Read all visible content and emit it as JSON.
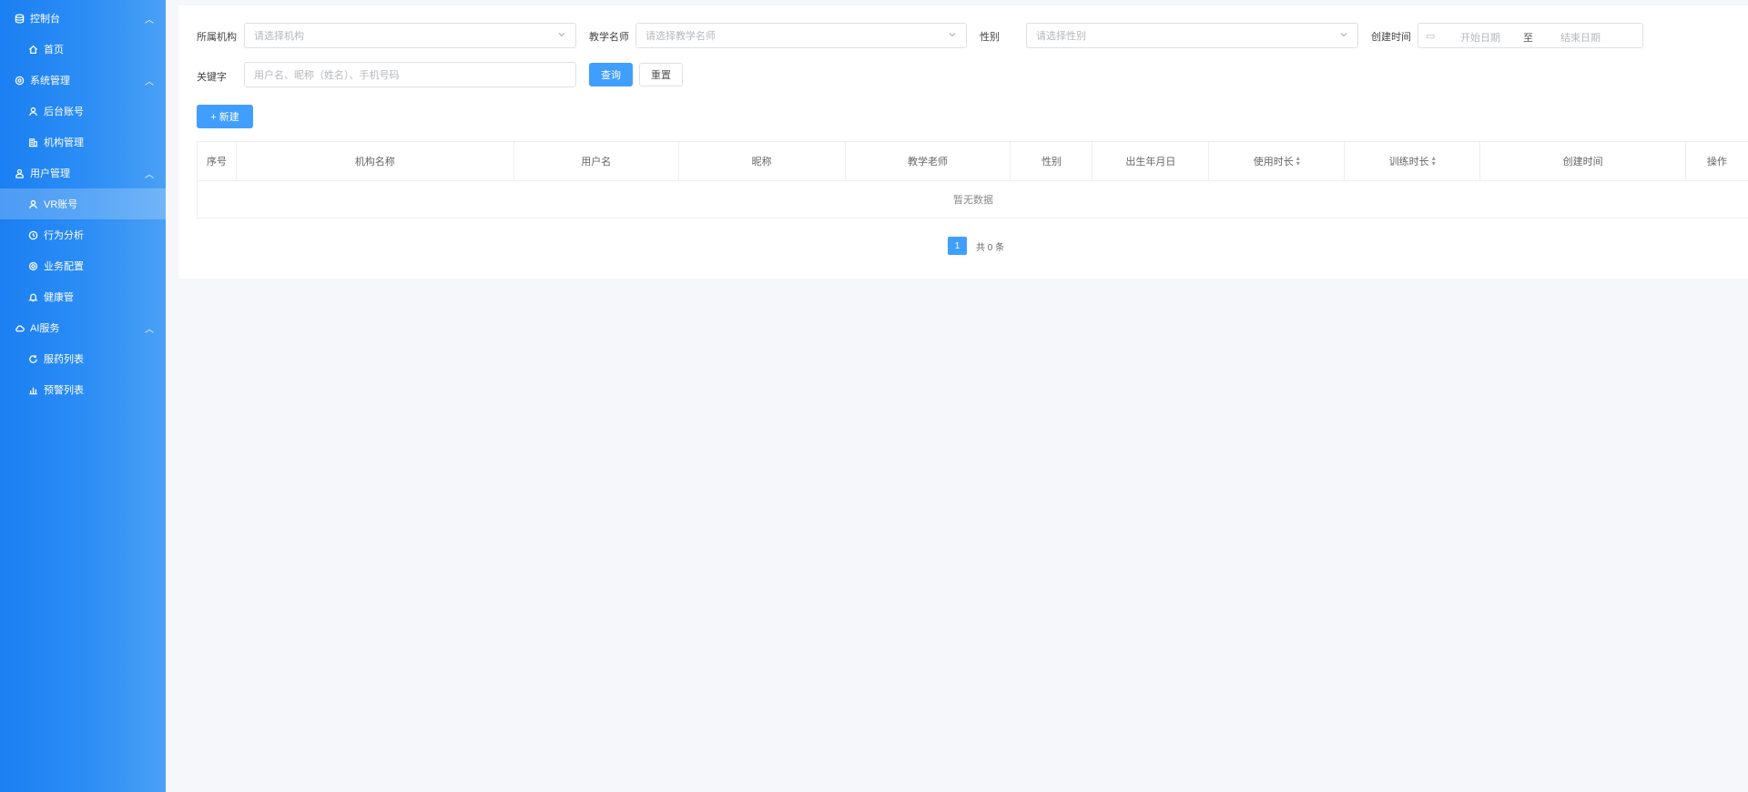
{
  "sidebar": {
    "groups": [
      {
        "label": "控制台",
        "icon": "database-icon",
        "items": [
          {
            "label": "首页",
            "icon": "home-icon"
          }
        ]
      },
      {
        "label": "系统管理",
        "icon": "settings-icon",
        "items": [
          {
            "label": "后台账号",
            "icon": "user-icon"
          },
          {
            "label": "机构管理",
            "icon": "building-icon"
          }
        ]
      },
      {
        "label": "用户管理",
        "icon": "person-icon",
        "items": [
          {
            "label": "VR账号",
            "icon": "user-icon",
            "active": true
          },
          {
            "label": "行为分析",
            "icon": "clock-icon"
          },
          {
            "label": "业务配置",
            "icon": "gear-icon"
          },
          {
            "label": "健康管",
            "icon": "bell-icon"
          }
        ]
      },
      {
        "label": "AI服务",
        "icon": "cloud-icon",
        "items": [
          {
            "label": "服药列表",
            "icon": "refresh-icon"
          },
          {
            "label": "预警列表",
            "icon": "chart-icon"
          }
        ]
      }
    ]
  },
  "filters": {
    "org_label": "所属机构",
    "org_placeholder": "请选择机构",
    "teacher_label": "教学名师",
    "teacher_placeholder": "请选择教学名师",
    "gender_label": "性别",
    "gender_placeholder": "请选择性别",
    "created_label": "创建时间",
    "date_from": "开始日期",
    "date_sep": "至",
    "date_to": "结束日期",
    "keyword_label": "关键字",
    "keyword_placeholder": "用户名、昵称（姓名）、手机号码"
  },
  "buttons": {
    "search": "查询",
    "reset": "重置",
    "create": "+ 新建"
  },
  "table": {
    "columns": [
      {
        "label": "序号"
      },
      {
        "label": "机构名称"
      },
      {
        "label": "用户名"
      },
      {
        "label": "昵称"
      },
      {
        "label": "教学老师"
      },
      {
        "label": "性别"
      },
      {
        "label": "出生年月日"
      },
      {
        "label": "使用时长",
        "sortable": true
      },
      {
        "label": "训练时长",
        "sortable": true
      },
      {
        "label": "创建时间"
      },
      {
        "label": "操作"
      }
    ],
    "empty_text": "暂无数据"
  },
  "pagination": {
    "current": "1",
    "total_text": "共 0 条"
  }
}
